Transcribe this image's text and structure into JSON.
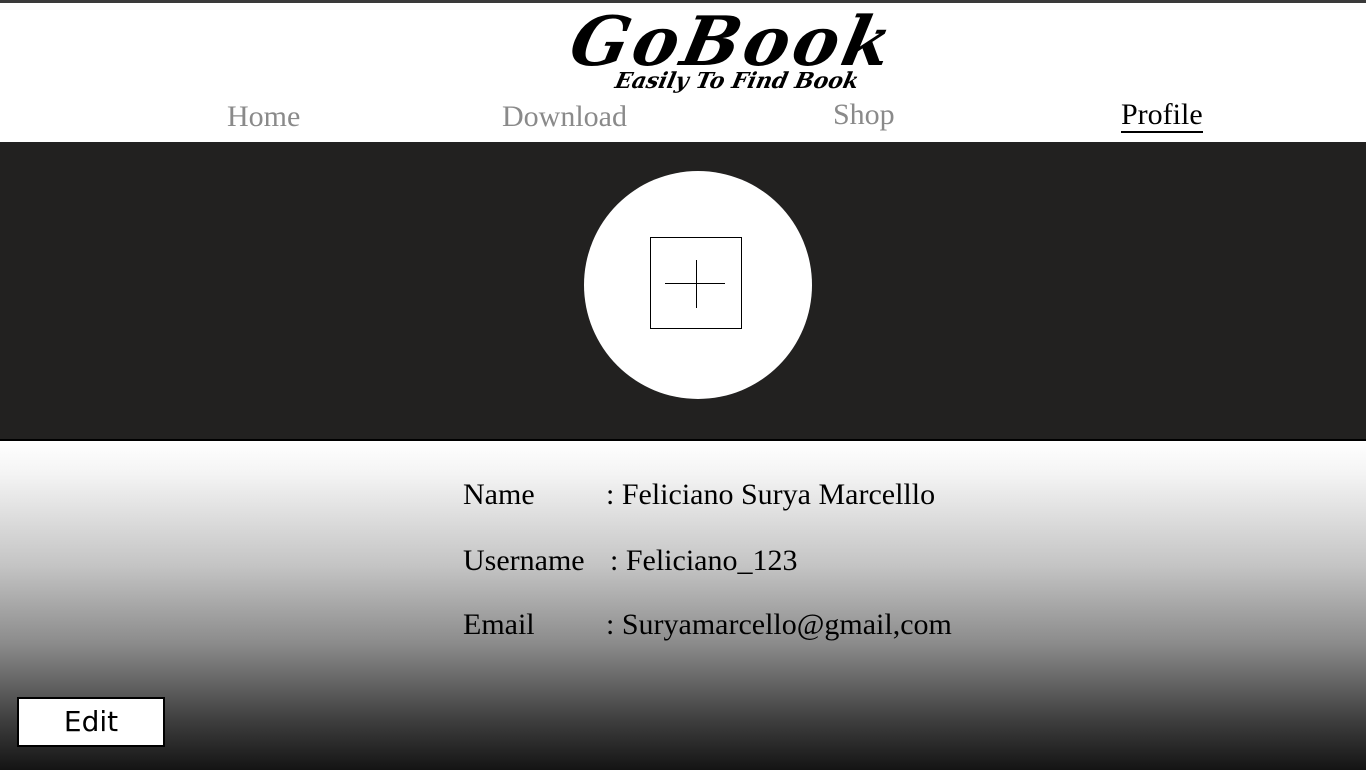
{
  "header": {
    "logo_title": "GoBook",
    "logo_tagline": "Easily To Find Book"
  },
  "nav": {
    "items": [
      {
        "label": "Home",
        "active": false
      },
      {
        "label": "Download",
        "active": false
      },
      {
        "label": "Shop",
        "active": false
      },
      {
        "label": "Profile",
        "active": true
      }
    ]
  },
  "profile": {
    "add_photo_icon": "plus-icon",
    "fields": [
      {
        "label": "Name",
        "value": ": Feliciano Surya Marcelllo"
      },
      {
        "label": "Username",
        "value": ": Feliciano_123"
      },
      {
        "label": "Email",
        "value": ": Suryamarcello@gmail,com"
      }
    ]
  },
  "actions": {
    "edit_label": "Edit"
  },
  "colors": {
    "banner": "#222120",
    "nav_inactive": "#8a8a8a",
    "nav_active": "#000000"
  }
}
